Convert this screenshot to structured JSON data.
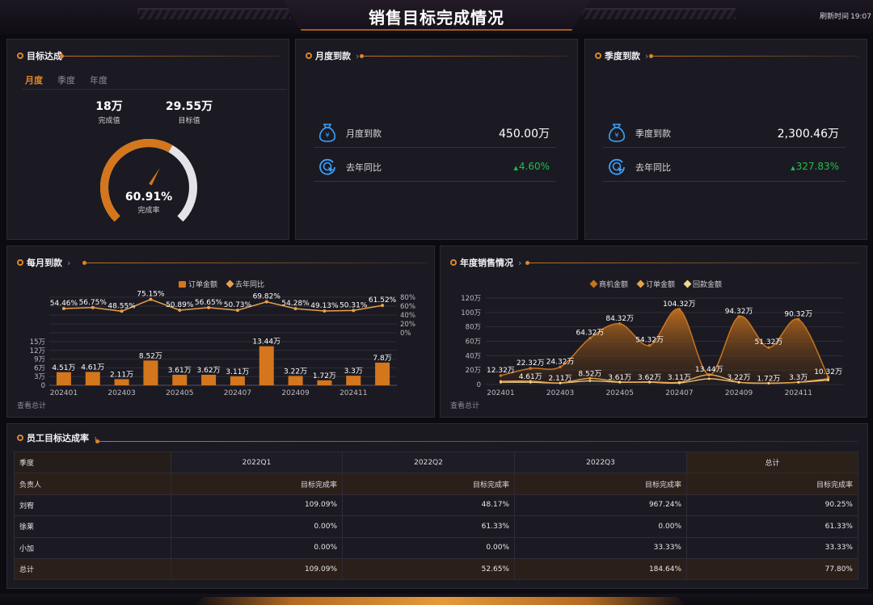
{
  "header": {
    "title": "销售目标完成情况",
    "refresh_label": "刷新时间",
    "refresh_time": "19:07"
  },
  "target": {
    "title": "目标达成",
    "tabs": [
      "月度",
      "季度",
      "年度"
    ],
    "completed_value": "18万",
    "completed_label": "完成值",
    "target_value": "29.55万",
    "target_label": "目标值",
    "rate_text": "60.91%",
    "rate_label": "完成率",
    "rate": 0.6091
  },
  "monthly_payment": {
    "title": "月度到款",
    "label": "月度到款",
    "value": "450.00万",
    "yoy_label": "去年同比",
    "yoy_value": "4.60%"
  },
  "quarterly_payment": {
    "title": "季度到款",
    "label": "季度到款",
    "value": "2,300.46万",
    "yoy_label": "去年同比",
    "yoy_value": "327.83%"
  },
  "monthly_chart": {
    "title": "每月到款",
    "view_all": "查看总计",
    "legend": [
      "订单金额",
      "去年同比"
    ],
    "chart_data": {
      "type": "bar",
      "categories": [
        "202401",
        "202402",
        "202403",
        "202404",
        "202405",
        "202406",
        "202407",
        "202408",
        "202409",
        "202410",
        "202411",
        "202412"
      ],
      "x_tick_labels": [
        "202401",
        "202403",
        "202405",
        "202407",
        "202409",
        "202411"
      ],
      "series": [
        {
          "name": "订单金额",
          "type": "bar",
          "values": [
            4.51,
            4.61,
            2.11,
            8.52,
            3.61,
            3.62,
            3.11,
            13.44,
            3.22,
            1.72,
            3.3,
            7.8
          ],
          "labels": [
            "4.51万",
            "4.61万",
            "2.11万",
            "8.52万",
            "3.61万",
            "3.62万",
            "3.11万",
            "13.44万",
            "3.22万",
            "1.72万",
            "3.3万",
            "7.8万"
          ]
        },
        {
          "name": "去年同比",
          "type": "line",
          "values": [
            54.46,
            56.75,
            48.55,
            75.15,
            50.89,
            56.65,
            50.73,
            69.82,
            54.28,
            49.13,
            50.31,
            61.52
          ],
          "labels": [
            "54.46%",
            "56.75%",
            "48.55%",
            "75.15%",
            "50.89%",
            "56.65%",
            "50.73%",
            "69.82%",
            "54.28%",
            "49.13%",
            "50.31%",
            "61.52%"
          ]
        }
      ],
      "y_left_ticks": [
        "0",
        "3万",
        "6万",
        "9万",
        "12万",
        "15万"
      ],
      "y_left_range": [
        0,
        15
      ],
      "y_right_ticks": [
        "0%",
        "20%",
        "40%",
        "60%",
        "80%"
      ],
      "y_right_range": [
        0,
        80
      ],
      "colors": {
        "bar": "#d4761c",
        "line": "#e8a14a"
      }
    }
  },
  "annual_chart": {
    "title": "年度销售情况",
    "view_all": "查看总计",
    "legend": [
      "商机金额",
      "订单金额",
      "回款金额"
    ],
    "chart_data": {
      "type": "area",
      "categories": [
        "202401",
        "202402",
        "202403",
        "202404",
        "202405",
        "202406",
        "202407",
        "202408",
        "202409",
        "202410",
        "202411",
        "202412"
      ],
      "x_tick_labels": [
        "202401",
        "202403",
        "202405",
        "202407",
        "202409",
        "202411"
      ],
      "series": [
        {
          "name": "商机金额",
          "values": [
            12.32,
            22.32,
            24.32,
            64.32,
            84.32,
            54.32,
            104.32,
            13.44,
            94.32,
            51.32,
            90.32,
            10.32
          ],
          "labels": [
            "12.32万",
            "22.32万",
            "24.32万",
            "64.32万",
            "84.32万",
            "54.32万",
            "104.32万",
            "13.44万",
            "94.32万",
            "51.32万",
            "90.32万",
            "10.32万"
          ]
        },
        {
          "name": "订单金额",
          "values": [
            4.51,
            4.61,
            2.11,
            8.52,
            3.61,
            3.62,
            3.11,
            13.44,
            3.22,
            1.72,
            3.3,
            7.8
          ],
          "labels": [
            "",
            "4.61万",
            "2.11万",
            "8.52万",
            "3.61万",
            "3.62万",
            "3.11万",
            "",
            "3.22万",
            "1.72万",
            "3.3万",
            ""
          ]
        },
        {
          "name": "回款金额",
          "values": [
            3,
            3,
            2,
            5,
            3,
            3,
            2,
            8,
            3,
            2,
            3,
            6
          ]
        }
      ],
      "y_ticks": [
        "0",
        "20万",
        "40万",
        "60万",
        "80万",
        "100万",
        "120万"
      ],
      "y_range": [
        0,
        120
      ],
      "colors": {
        "opportunity": "#c9741f",
        "order": "#e8a14a",
        "payment": "#f3d58f"
      }
    }
  },
  "employee_table": {
    "title": "员工目标达成率",
    "header_row1": [
      "季度",
      "2022Q1",
      "2022Q2",
      "2022Q3",
      "总计"
    ],
    "header_row2": [
      "负责人",
      "目标完成率",
      "目标完成率",
      "目标完成率",
      "目标完成率"
    ],
    "rows": [
      [
        "刘宥",
        "109.09%",
        "48.17%",
        "967.24%",
        "90.25%"
      ],
      [
        "徐莱",
        "0.00%",
        "61.33%",
        "0.00%",
        "61.33%"
      ],
      [
        "小加",
        "0.00%",
        "0.00%",
        "33.33%",
        "33.33%"
      ]
    ],
    "total_row": [
      "总计",
      "109.09%",
      "52.65%",
      "184.64%",
      "77.80%"
    ]
  }
}
